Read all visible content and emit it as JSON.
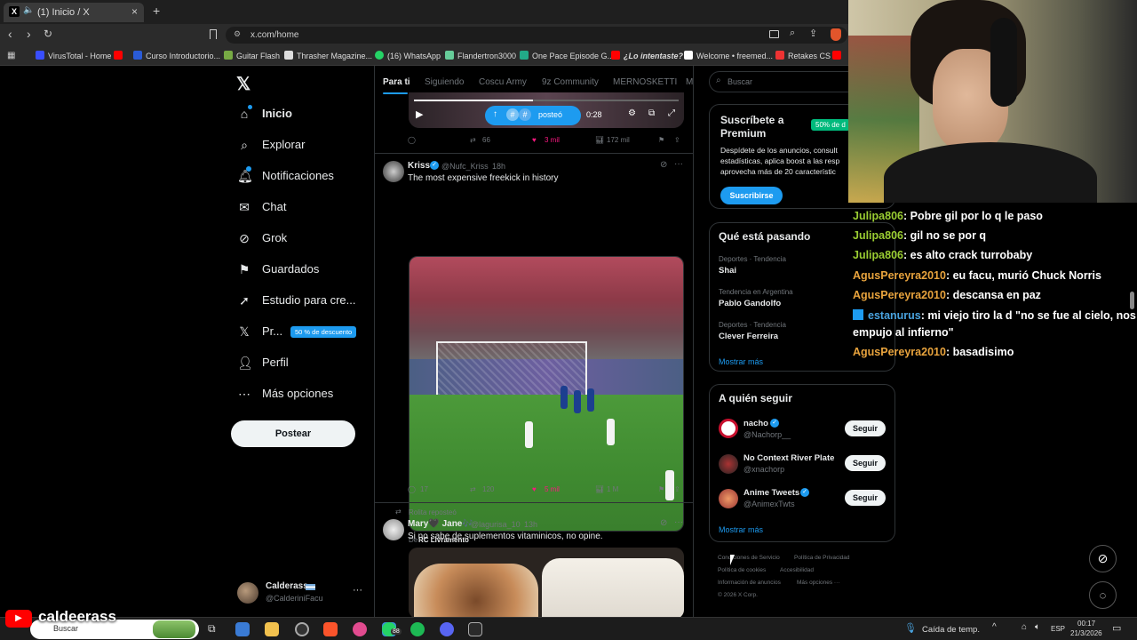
{
  "browser": {
    "tab_title": "(1) Inicio / X",
    "url": "x.com/home",
    "bookmarks": [
      "VirusTotal - Home",
      "Curso Introductorio...",
      "Guitar Flash",
      "Thrasher Magazine...",
      "(16) WhatsApp",
      "Flandertron3000",
      "One Pace Episode G...",
      "¿Lo intentaste?",
      "Welcome • freemed...",
      "Retakes CS"
    ]
  },
  "sidebar": {
    "items": [
      {
        "label": "Inicio",
        "icon": "home-icon"
      },
      {
        "label": "Explorar",
        "icon": "search-icon"
      },
      {
        "label": "Notificaciones",
        "icon": "bell-icon"
      },
      {
        "label": "Chat",
        "icon": "mail-icon"
      },
      {
        "label": "Grok",
        "icon": "grok-icon"
      },
      {
        "label": "Guardados",
        "icon": "bookmark-icon"
      },
      {
        "label": "Estudio para cre...",
        "icon": "rocket-icon"
      },
      {
        "label": "Pr...",
        "icon": "x-logo-icon"
      },
      {
        "label": "Perfil",
        "icon": "person-icon"
      },
      {
        "label": "Más opciones",
        "icon": "more-circle-icon"
      }
    ],
    "premium_badge": "50 % de descuento",
    "post_button": "Postear",
    "account": {
      "name": "Calderass",
      "handle": "@CalderiniFacu"
    }
  },
  "timeline": {
    "tabs": [
      "Para ti",
      "Siguiendo",
      "Coscu Army",
      "9z Community",
      "MERNOSKETTI",
      "M"
    ],
    "video_overlay": {
      "label": "posteó",
      "time": "0:28"
    },
    "tweet0_actions": {
      "replies": "66",
      "reposts": "",
      "likes": "3 mil",
      "views": "172 mil"
    },
    "tweets": [
      {
        "name": "Kriss",
        "handle": "@Nufc_Kriss",
        "time": "18h",
        "text": "The most expensive freekick in history",
        "source_prefix": "De",
        "source": "RC Livramento",
        "replies": "17",
        "reposts": "120",
        "likes": "5 mil",
        "views": "1 M"
      },
      {
        "reposted_by": "Rolita reposteó",
        "name": "Mary🖤 Jane🎶",
        "handle": "@lagurisa_10",
        "time": "13h",
        "text": "Si no sabe de suplementos vitaminicos, no opine."
      }
    ]
  },
  "right": {
    "search_placeholder": "Buscar",
    "premium": {
      "title": "Suscríbete a Premium",
      "badge": "50% de d",
      "body": "Despídete de los anuncios, consult estadísticas, aplica boost a las resp aprovecha más de 20 característic",
      "button": "Suscribirse"
    },
    "trends": {
      "title": "Qué está pasando",
      "items": [
        {
          "category": "Deportes · Tendencia",
          "name": "Shai"
        },
        {
          "category": "Tendencia en Argentina",
          "name": "Pablo Gandolfo"
        },
        {
          "category": "Deportes · Tendencia",
          "name": "Clever Ferreira"
        }
      ],
      "more": "Mostrar más"
    },
    "follow": {
      "title": "A quién seguir",
      "items": [
        {
          "name": "nacho",
          "handle": "@Nachorp__",
          "button": "Seguir"
        },
        {
          "name": "No Context River Plate",
          "handle": "@xnachorp",
          "button": "Seguir"
        },
        {
          "name": "Anime Tweets",
          "handle": "@AnimexTwts",
          "button": "Seguir"
        }
      ],
      "more": "Mostrar más"
    },
    "footer": [
      "Condiciones de Servicio",
      "Política de Privacidad",
      "Política de cookies",
      "Accesibilidad",
      "Información de anuncios",
      "Más opciones ···",
      "© 2026 X Corp."
    ]
  },
  "chat": {
    "lines": [
      {
        "user": "Julipa806",
        "msg": ": Pobre gil por lo q le paso",
        "color": "green"
      },
      {
        "user": "Julipa806",
        "msg": ": gil no se por q",
        "color": "green"
      },
      {
        "user": "Julipa806",
        "msg": ": es alto crack turrobaby",
        "color": "green"
      },
      {
        "user": "AgusPereyra2010",
        "msg": ": eu facu, murió Chuck Norris",
        "color": "orange"
      },
      {
        "user": "AgusPereyra2010",
        "msg": ": descansa en paz",
        "color": "orange"
      },
      {
        "user": "estanurus",
        "msg": ": mi viejo tiro la d \"no se fue al cielo, nos",
        "msg2": "empujo al infierno\"",
        "color": "blue"
      },
      {
        "user": "AgusPereyra2010",
        "msg": ": basadisimo",
        "color": "orange"
      }
    ]
  },
  "stream": {
    "channel": "caldeerass"
  },
  "taskbar": {
    "search": "Buscar",
    "weather": "Caída de temp.",
    "lang": "ESP",
    "time": "00:17",
    "date": "21/3/2026",
    "whatsapp_badge": "88"
  }
}
